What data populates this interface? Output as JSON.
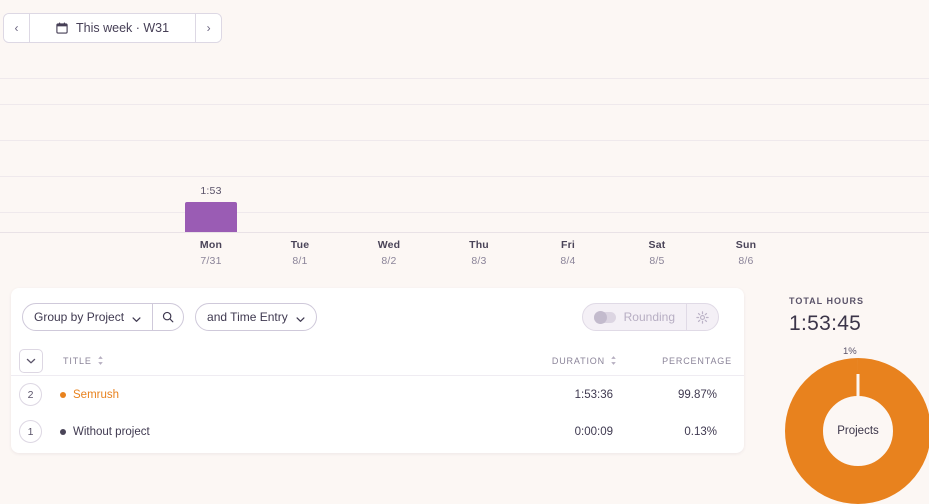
{
  "datenav": {
    "prev_label": "‹",
    "next_label": "›",
    "range_label": "This week · W31",
    "calendar_icon": "calendar-icon"
  },
  "chart_data": {
    "type": "bar",
    "title": "",
    "xlabel": "",
    "ylabel": "",
    "categories": [
      "Mon",
      "Tue",
      "Wed",
      "Thu",
      "Fri",
      "Sat",
      "Sun"
    ],
    "tick_dates": [
      "7/31",
      "8/1",
      "8/2",
      "8/3",
      "8/4",
      "8/5",
      "8/6"
    ],
    "values": [
      1.883,
      0,
      0,
      0,
      0,
      0,
      0
    ],
    "value_labels": [
      "1:53",
      "",
      "",
      "",
      "",
      "",
      ""
    ],
    "bar_color": "#9a5cb4",
    "grid": true,
    "gridlines": 5,
    "ylim": [
      0,
      2.2
    ]
  },
  "toolbar": {
    "group_by_label": "Group by Project",
    "search_icon": "search-icon",
    "caret_icon": "chevron-down-icon",
    "secondary_filter_label": "and Time Entry",
    "rounding_label": "Rounding",
    "rounding_enabled": false,
    "gear_icon": "gear-icon"
  },
  "table": {
    "expand_icon": "chevron-down-icon",
    "columns": {
      "title": "TITLE",
      "duration": "DURATION",
      "percentage": "PERCENTAGE"
    },
    "rows": [
      {
        "count": "2",
        "title": "Semrush",
        "dot_color": "#E8821E",
        "title_color": "#E8821E",
        "duration": "1:53:36",
        "percentage": "99.87%"
      },
      {
        "count": "1",
        "title": "Without project",
        "dot_color": "#4a4458",
        "title_color": "#3f3950",
        "duration": "0:00:09",
        "percentage": "0.13%"
      }
    ]
  },
  "summary": {
    "total_hours_label": "TOTAL HOURS",
    "total_hours_value": "1:53:45",
    "donut_top_label": "1%",
    "donut_center_label": "Projects",
    "donut_color": "#E8821E",
    "donut_data": {
      "type": "pie",
      "labels": [
        "Semrush",
        "Without project"
      ],
      "values": [
        99.87,
        0.13
      ],
      "colors": [
        "#E8821E",
        "#E8821E"
      ]
    }
  }
}
